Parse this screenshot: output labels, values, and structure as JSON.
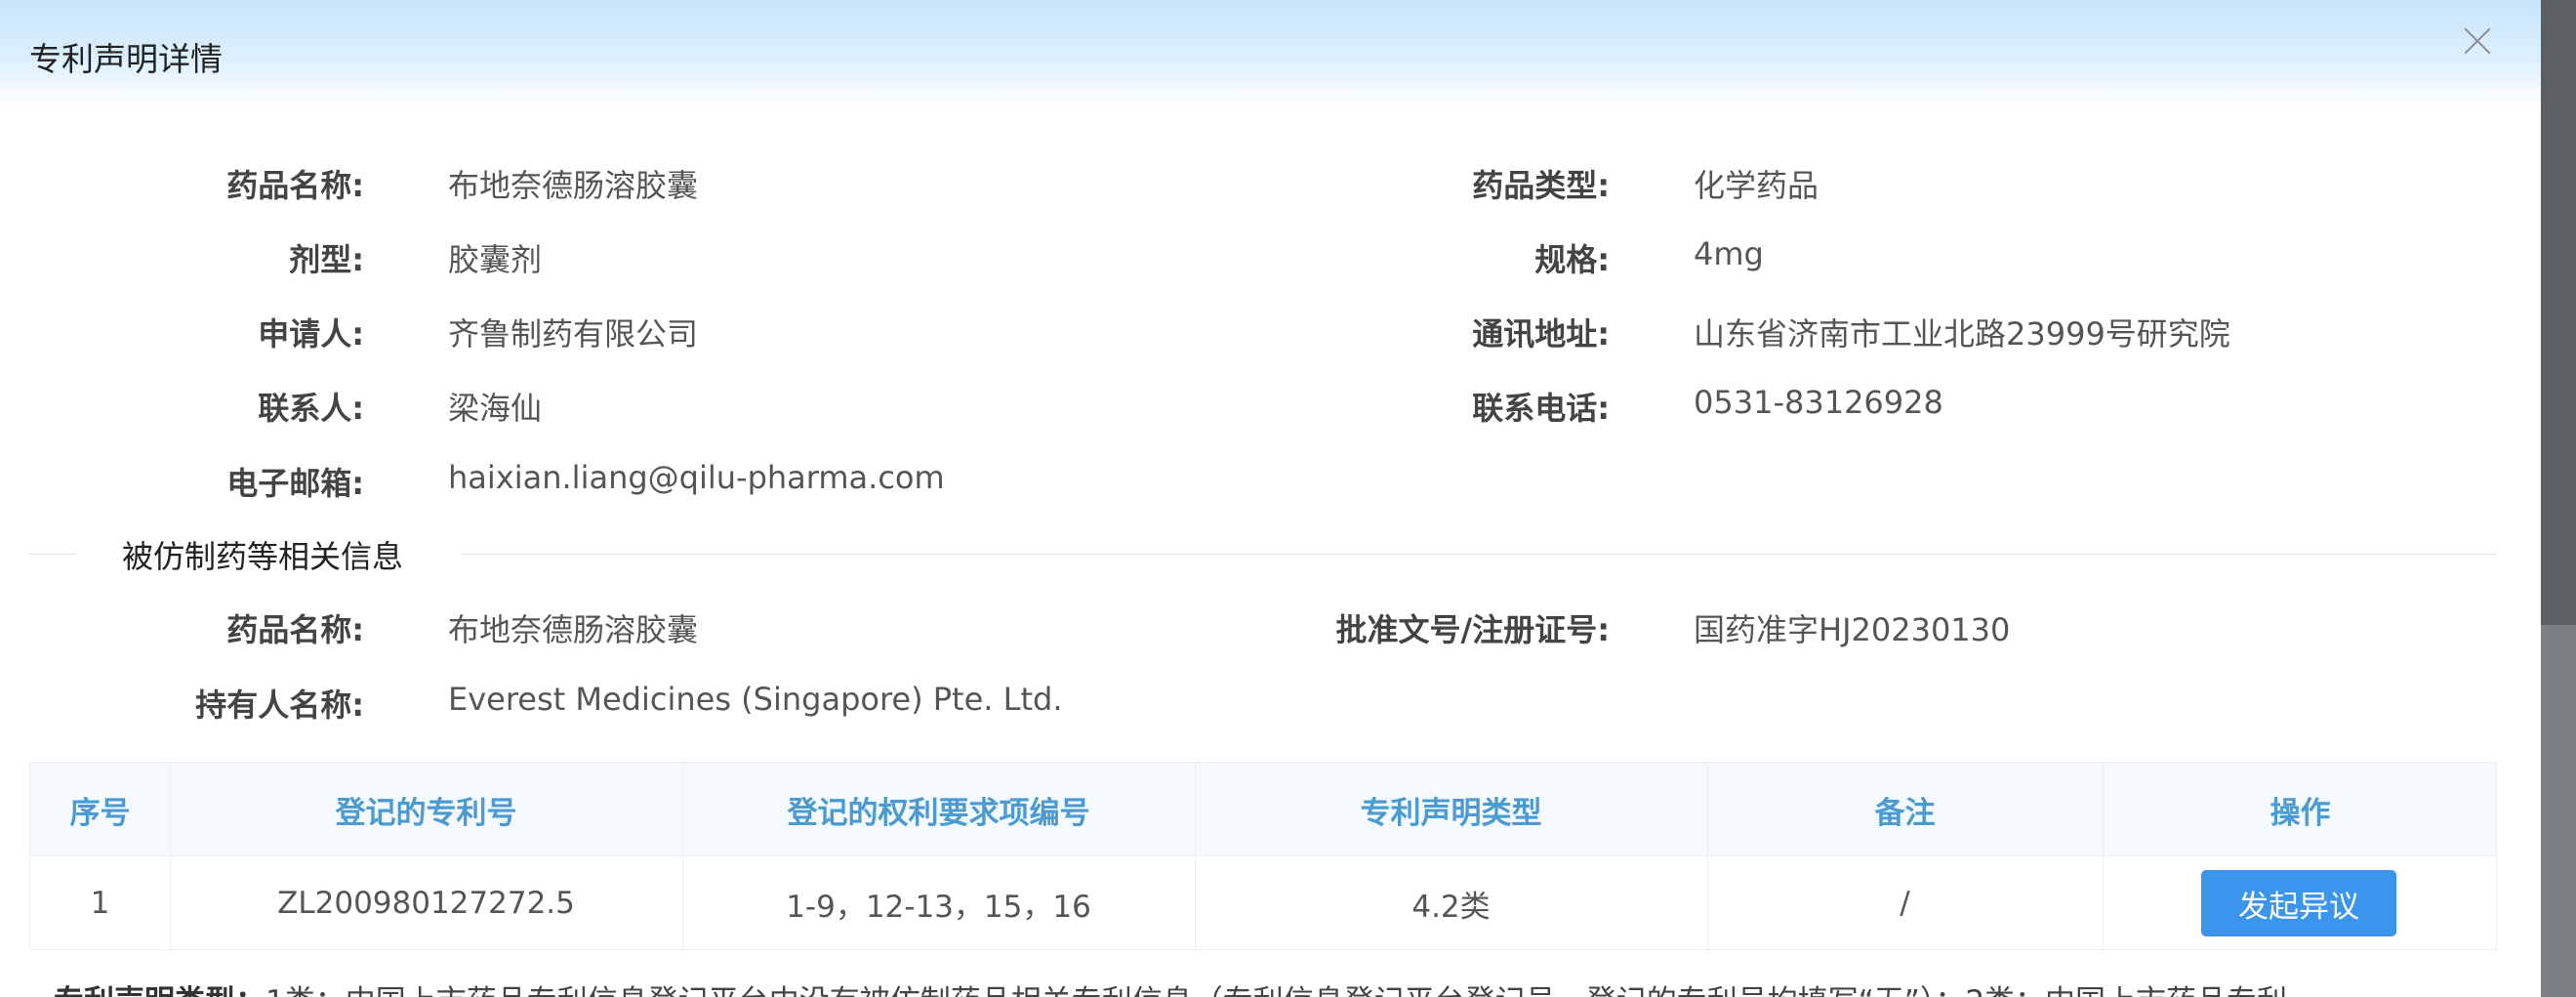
{
  "dialog": {
    "title": "专利声明详情"
  },
  "drug_info": {
    "drug_name": {
      "label": "药品名称:",
      "value": "布地奈德肠溶胶囊"
    },
    "drug_type": {
      "label": "药品类型:",
      "value": "化学药品"
    },
    "dosage_form": {
      "label": "剂型:",
      "value": "胶囊剂"
    },
    "specification": {
      "label": "规格:",
      "value": "4mg"
    },
    "applicant": {
      "label": "申请人:",
      "value": "齐鲁制药有限公司"
    },
    "address": {
      "label": "通讯地址:",
      "value": "山东省济南市工业北路23999号研究院"
    },
    "contact": {
      "label": "联系人:",
      "value": "梁海仙"
    },
    "phone": {
      "label": "联系电话:",
      "value": "0531-83126928"
    },
    "email": {
      "label": "电子邮箱:",
      "value": "haixian.liang@qilu-pharma.com"
    }
  },
  "reference_drug": {
    "section_title": "被仿制药等相关信息",
    "drug_name": {
      "label": "药品名称:",
      "value": "布地奈德肠溶胶囊"
    },
    "approval_no": {
      "label": "批准文号/注册证号:",
      "value": "国药准字HJ20230130"
    },
    "holder": {
      "label": "持有人名称:",
      "value": "Everest Medicines (Singapore) Pte. Ltd."
    }
  },
  "table": {
    "headers": [
      "序号",
      "登记的专利号",
      "登记的权利要求项编号",
      "专利声明类型",
      "备注",
      "操作"
    ],
    "rows": [
      {
        "index": "1",
        "patent_no": "ZL200980127272.5",
        "claims": "1-9，12-13，15，16",
        "statement_type": "4.2类",
        "remark": "/",
        "action": "发起异议"
      }
    ]
  },
  "footnote": {
    "label": "专利声明类型：",
    "text": "1类：中国上市药品专利信息登记平台中没有被仿制药品相关专利信息（专利信息登记平台登记号，登记的专利号均填写“无”）；2类：中国上市药品专利"
  }
}
